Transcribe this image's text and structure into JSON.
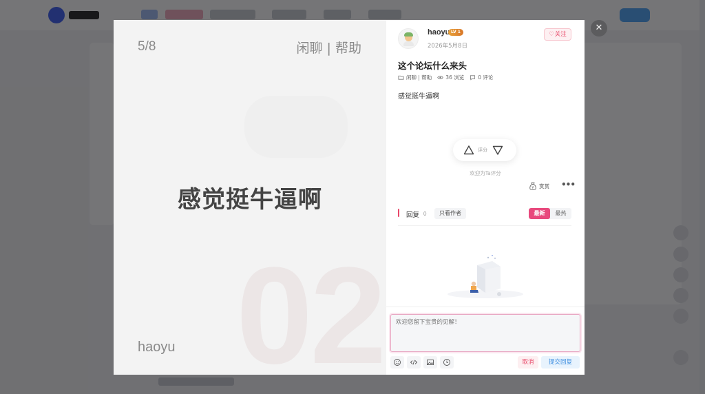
{
  "poster": {
    "page_indicator": "5/8",
    "category": "闲聊 | 帮助",
    "headline": "感觉挺牛逼啊",
    "author": "haoyu",
    "background_number": "02"
  },
  "post": {
    "username": "haoyu",
    "level_badge": "LV 1",
    "date": "2026年5月8日",
    "follow_label": "关注",
    "title": "这个论坛什么来头",
    "category": "闲聊 | 帮助",
    "views": "36 浏览",
    "comments": "0 评论",
    "body": "感觉挺牛逼啊"
  },
  "rating": {
    "label": "评分",
    "hint": "欢迎为Ta评分"
  },
  "actions": {
    "reward_label": "赏赏",
    "more_label": "•••"
  },
  "replies": {
    "title": "回复",
    "count": "0",
    "author_only": "只看作者",
    "sort_latest": "最新",
    "sort_hottest": "最热"
  },
  "composer": {
    "placeholder": "欢迎您留下宝贵的见解！",
    "cancel_label": "取消",
    "submit_label": "提交回复"
  },
  "modal": {
    "close_label": "✕"
  },
  "icons": [
    "folder-icon",
    "eye-icon",
    "comment-icon",
    "heart-icon",
    "triangle-up-icon",
    "triangle-down-icon",
    "money-bag-icon",
    "emoji-icon",
    "code-icon",
    "image-icon",
    "sticker-icon",
    "close-icon"
  ],
  "colors": {
    "accent_pink": "#e8497d",
    "cancel_red": "#e8496a",
    "submit_blue": "#3d8ee0",
    "level_orange": "#e8a23c"
  }
}
